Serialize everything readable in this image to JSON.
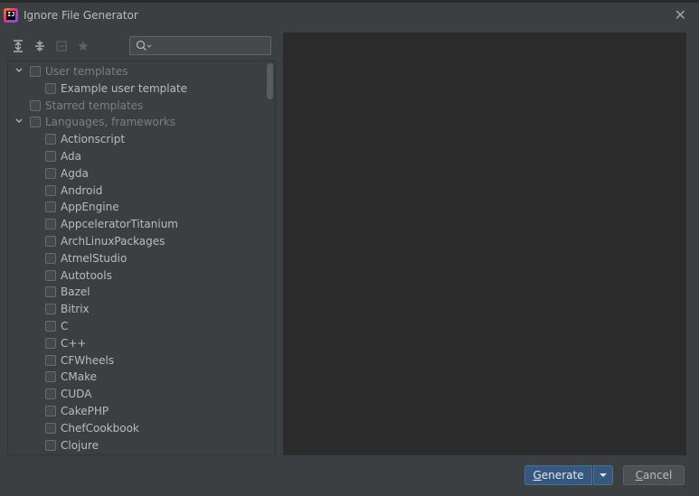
{
  "window": {
    "title": "Ignore File Generator",
    "app_icon_text": "IJ"
  },
  "toolbar": {
    "buttons": [
      {
        "name": "expand-all-icon"
      },
      {
        "name": "collapse-all-icon"
      },
      {
        "name": "uncheck-all-icon"
      },
      {
        "name": "star-icon"
      }
    ]
  },
  "search": {
    "value": "",
    "placeholder": ""
  },
  "tree": {
    "rows": [
      {
        "label": "User templates",
        "level": 0,
        "expanded": true,
        "dim": true
      },
      {
        "label": "Example user template",
        "level": 1,
        "dim": false
      },
      {
        "label": "Starred templates",
        "level": 0,
        "dim": true
      },
      {
        "label": "Languages, frameworks",
        "level": 0,
        "expanded": true,
        "dim": true
      },
      {
        "label": "Actionscript",
        "level": 1,
        "dim": false
      },
      {
        "label": "Ada",
        "level": 1,
        "dim": false
      },
      {
        "label": "Agda",
        "level": 1,
        "dim": false
      },
      {
        "label": "Android",
        "level": 1,
        "dim": false
      },
      {
        "label": "AppEngine",
        "level": 1,
        "dim": false
      },
      {
        "label": "AppceleratorTitanium",
        "level": 1,
        "dim": false
      },
      {
        "label": "ArchLinuxPackages",
        "level": 1,
        "dim": false
      },
      {
        "label": "AtmelStudio",
        "level": 1,
        "dim": false
      },
      {
        "label": "Autotools",
        "level": 1,
        "dim": false
      },
      {
        "label": "Bazel",
        "level": 1,
        "dim": false
      },
      {
        "label": "Bitrix",
        "level": 1,
        "dim": false
      },
      {
        "label": "C",
        "level": 1,
        "dim": false
      },
      {
        "label": "C++",
        "level": 1,
        "dim": false
      },
      {
        "label": "CFWheels",
        "level": 1,
        "dim": false
      },
      {
        "label": "CMake",
        "level": 1,
        "dim": false
      },
      {
        "label": "CUDA",
        "level": 1,
        "dim": false
      },
      {
        "label": "CakePHP",
        "level": 1,
        "dim": false
      },
      {
        "label": "ChefCookbook",
        "level": 1,
        "dim": false
      },
      {
        "label": "Clojure",
        "level": 1,
        "dim": false
      }
    ]
  },
  "buttons": {
    "generate": {
      "mnemonic": "G",
      "rest": "enerate"
    },
    "cancel": {
      "mnemonic": "C",
      "rest": "ancel"
    }
  },
  "colors": {
    "background": "#3c3f41",
    "preview_background": "#2b2b2b",
    "primary_button": "#365880"
  }
}
